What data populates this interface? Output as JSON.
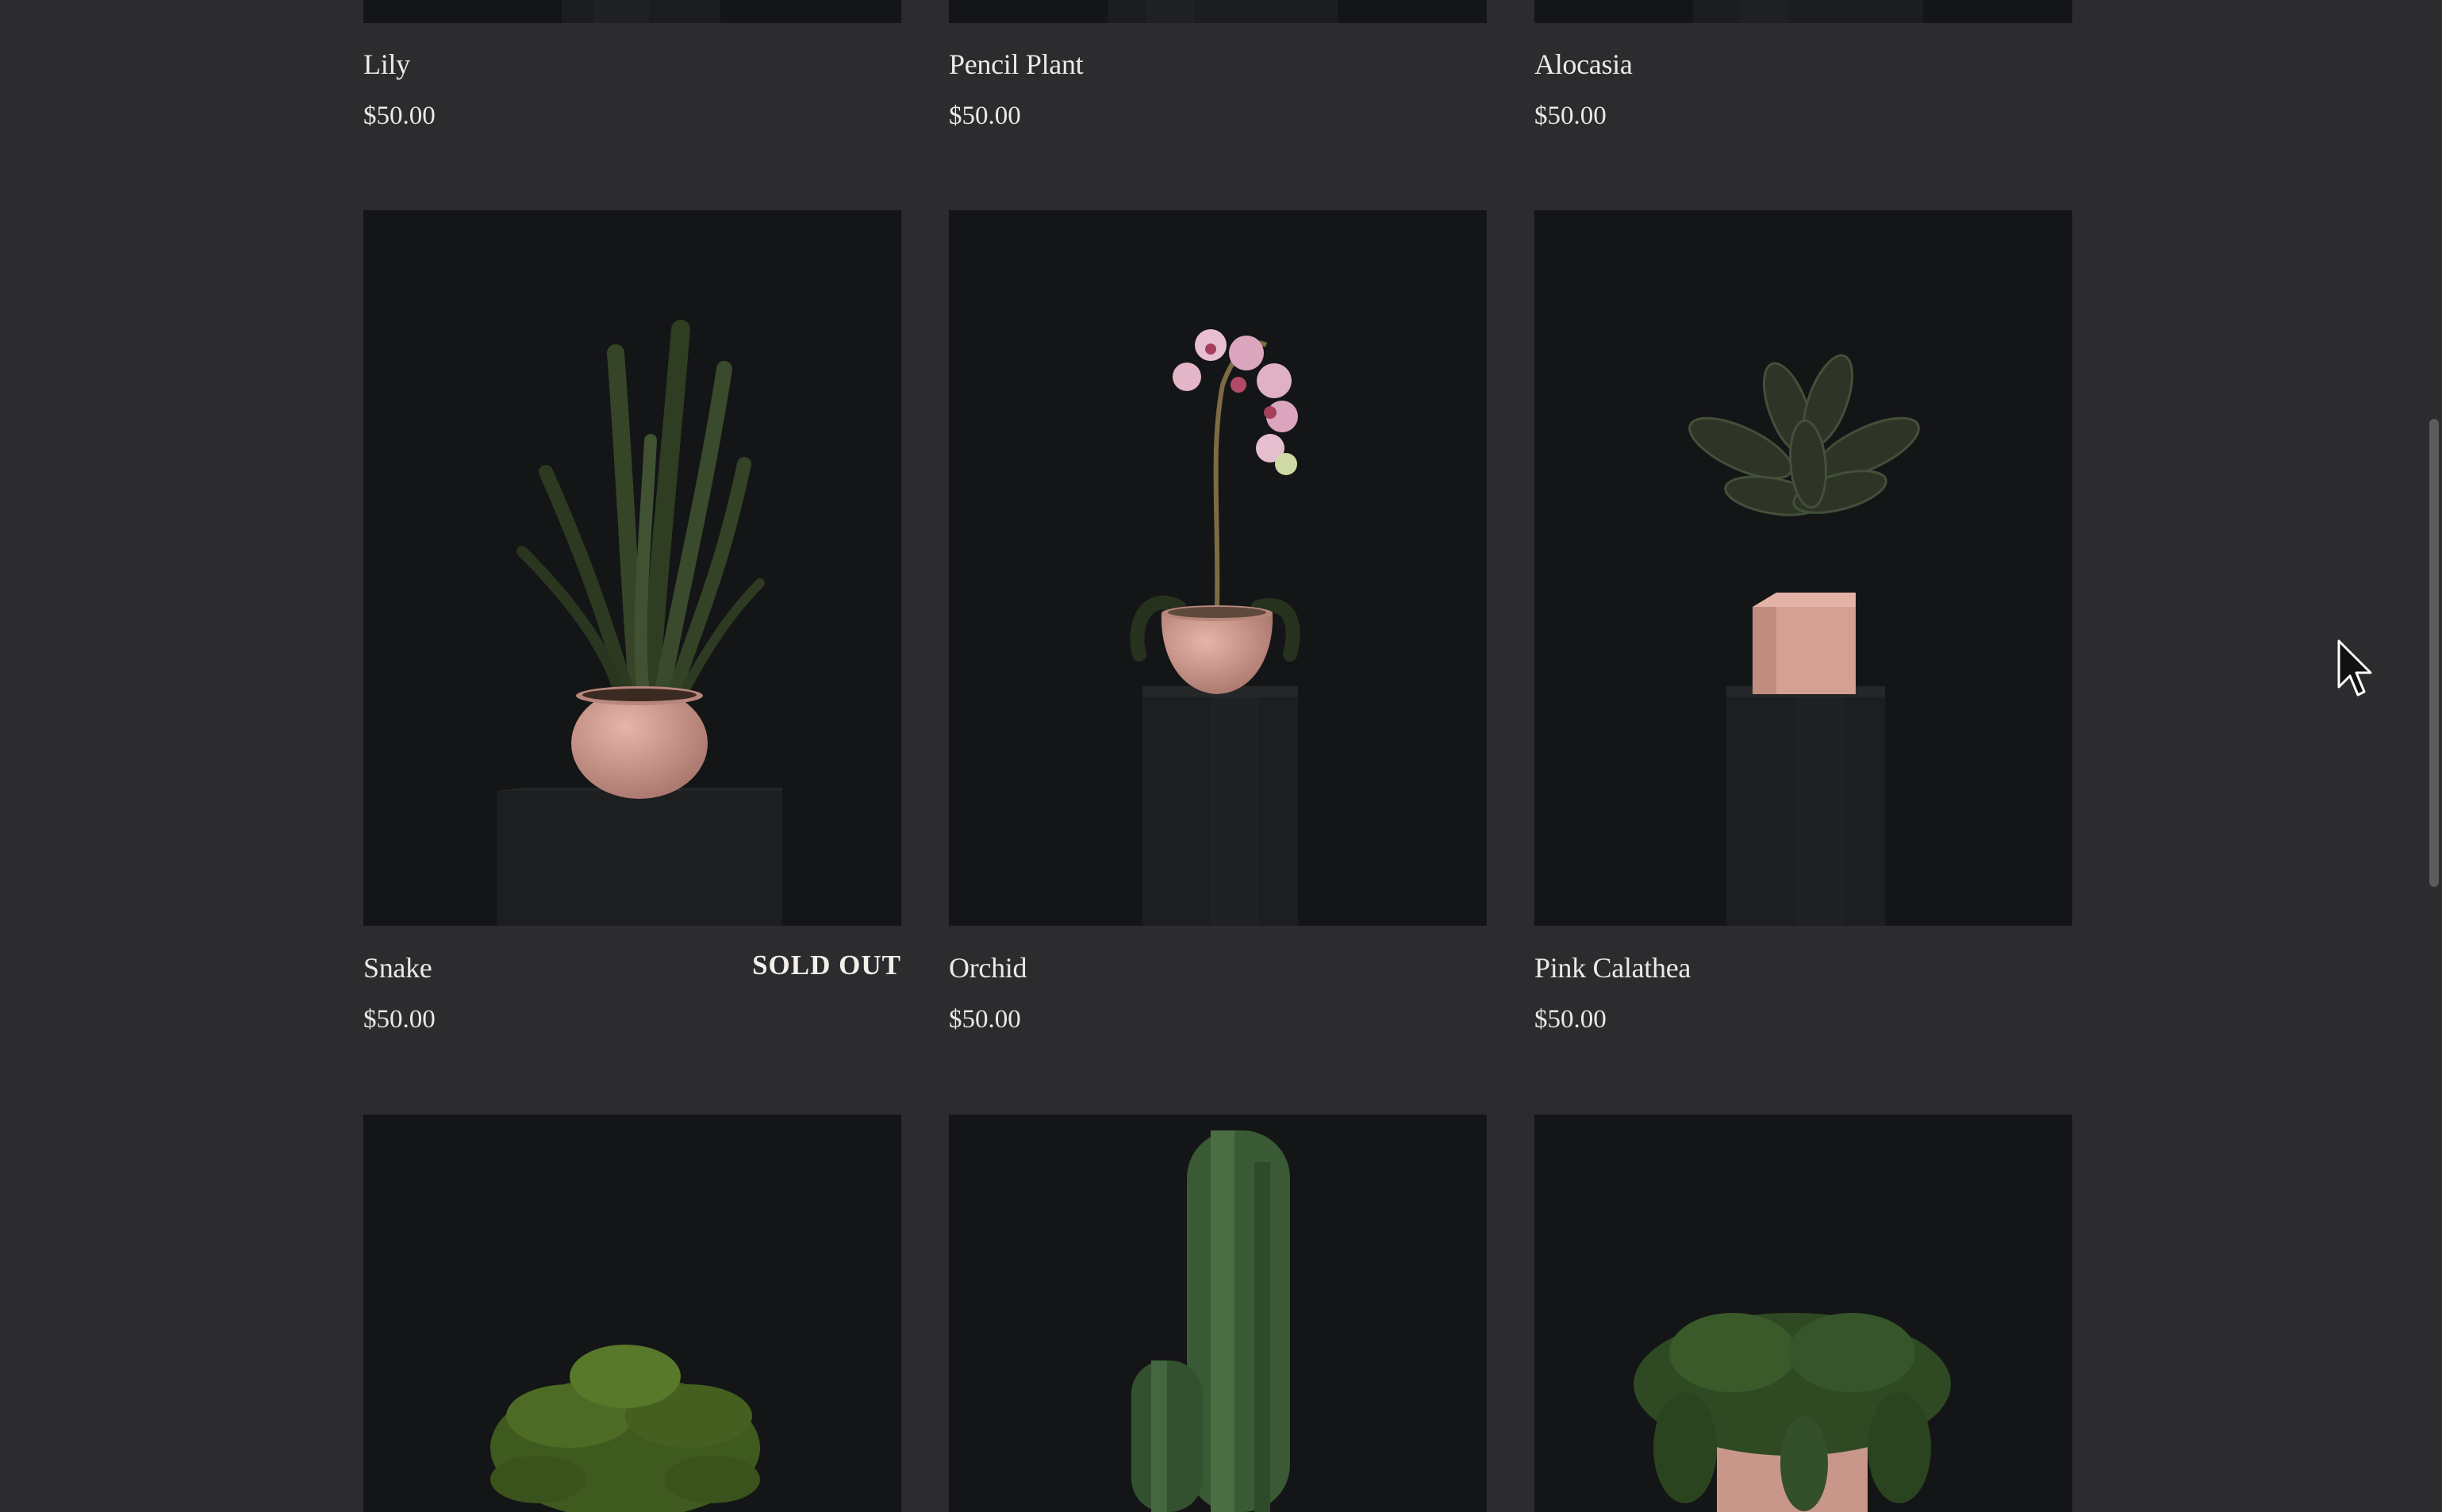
{
  "products": {
    "row_top": [
      {
        "name": "Lily",
        "price": "$50.00"
      },
      {
        "name": "Pencil Plant",
        "price": "$50.00"
      },
      {
        "name": "Alocasia",
        "price": "$50.00"
      }
    ],
    "row_middle": [
      {
        "name": "Snake",
        "price": "$50.00",
        "badge": "SOLD OUT"
      },
      {
        "name": "Orchid",
        "price": "$50.00"
      },
      {
        "name": "Pink Calathea",
        "price": "$50.00"
      }
    ]
  },
  "images": {
    "snake": "snake-plant-photo",
    "orchid": "orchid-photo",
    "pink_calathea": "pink-calathea-photo",
    "fern": "fern-photo",
    "cactus": "cactus-photo",
    "trailing_plant": "trailing-plant-photo"
  },
  "colors": {
    "background": "#2c2c2f",
    "photo_background": "#151617",
    "text": "#ece9e4",
    "pot_pink": "#d7a297",
    "leaf_green": "#3c4a2e"
  },
  "cursor": "arrow-pointer-icon"
}
